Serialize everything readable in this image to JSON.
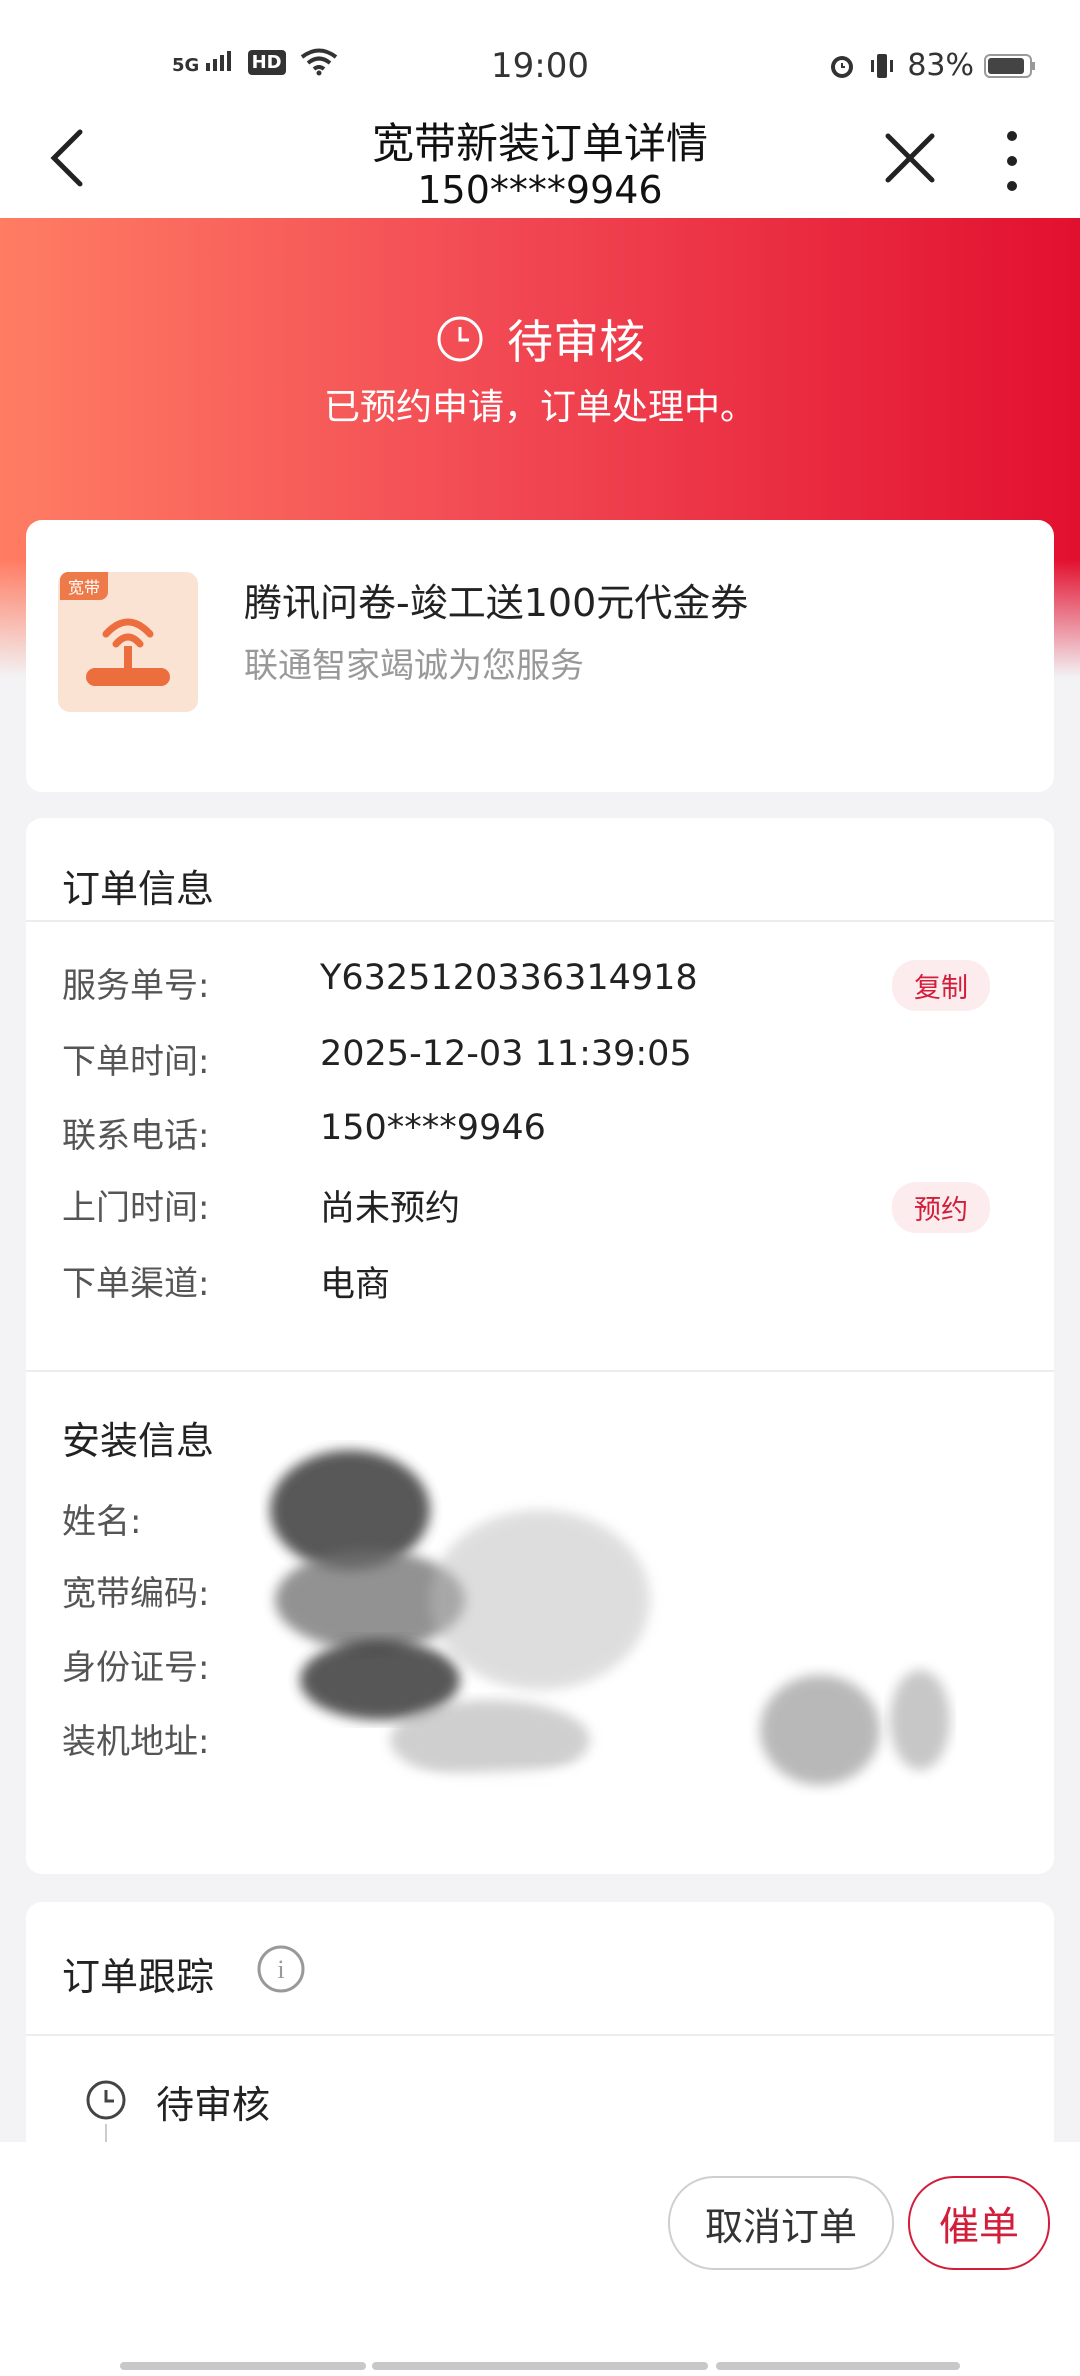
{
  "status_bar": {
    "time": "19:00",
    "network": "5G",
    "hd": "HD",
    "battery": "83%"
  },
  "nav": {
    "title": "宽带新装订单详情",
    "subtitle": "150****9946"
  },
  "banner": {
    "status": "待审核",
    "message": "已预约申请，订单处理中。"
  },
  "promo": {
    "tag": "宽带",
    "title": "腾讯问卷-竣工送100元代金券",
    "subtitle": "联通智家竭诚为您服务"
  },
  "order_info": {
    "title": "订单信息",
    "rows": [
      {
        "label": "服务单号:",
        "value": "Y6325120336314918",
        "action": "复制"
      },
      {
        "label": "下单时间:",
        "value": "2025-12-03 11:39:05"
      },
      {
        "label": "联系电话:",
        "value": "150****9946"
      },
      {
        "label": "上门时间:",
        "value": "尚未预约",
        "action": "预约"
      },
      {
        "label": "下单渠道:",
        "value": "电商"
      }
    ]
  },
  "install_info": {
    "title": "安装信息",
    "labels": [
      "姓名:",
      "宽带编码:",
      "身份证号:",
      "装机地址:"
    ]
  },
  "tracking": {
    "title": "订单跟踪",
    "info_icon_text": "i",
    "first_status": "待审核"
  },
  "actions": {
    "cancel": "取消订单",
    "urge": "催单"
  },
  "colors": {
    "accent": "#d21e3a",
    "banner_start": "#ff7d63",
    "banner_end": "#e2102f"
  }
}
